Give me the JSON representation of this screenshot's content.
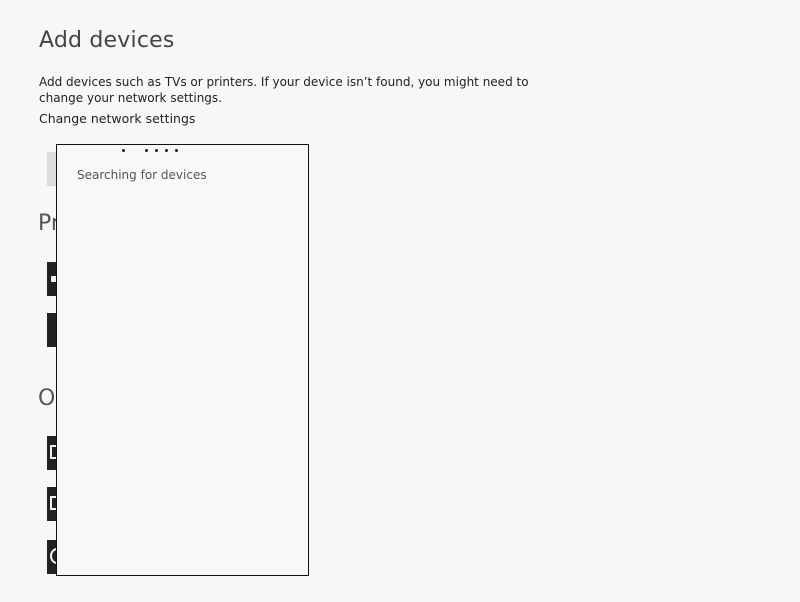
{
  "page": {
    "title": "Add devices",
    "description": "Add devices such as TVs or printers. If your device isn’t found, you might need to change your network settings.",
    "change_network_link": "Change network settings"
  },
  "sections": {
    "printers_heading_visible": "Pr",
    "other_heading_visible": "O"
  },
  "flyout": {
    "status": "Searching for devices",
    "progress_dot_count": 5
  },
  "colors": {
    "background": "#f7f7f7",
    "tile": "#222222",
    "flyout_border": "#111111"
  }
}
